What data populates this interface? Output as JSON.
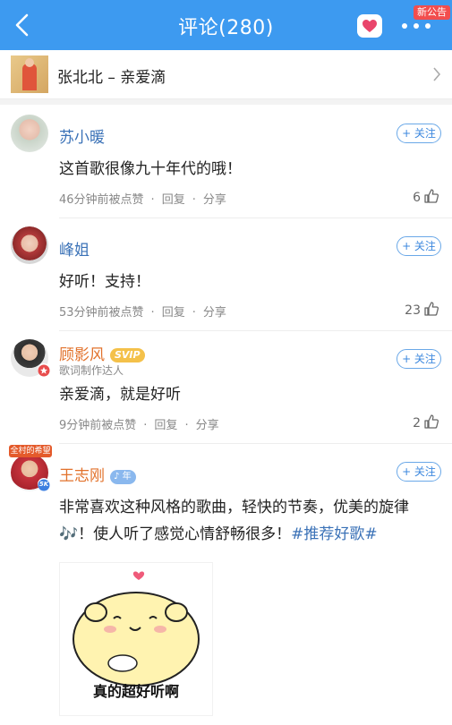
{
  "header": {
    "title": "评论(280)",
    "badge": "新公告",
    "back_icon": "back-chevron-icon",
    "heart_icon": "heart-icon",
    "more_icon": "more-dots-icon",
    "bg_color": "#3d9af0"
  },
  "song": {
    "title": "张北北 – 亲爱滴",
    "chevron_icon": "chevron-right-icon"
  },
  "comments": [
    {
      "name": "苏小暖",
      "text": "这首歌很像九十年代的哦！",
      "time": "46分钟前被点赞",
      "reply": "回复",
      "share": "分享",
      "likes": "6",
      "follow": "+ 关注"
    },
    {
      "name": "峰姐",
      "text": "好听！支持！",
      "time": "53分钟前被点赞",
      "reply": "回复",
      "share": "分享",
      "likes": "23",
      "follow": "+ 关注"
    },
    {
      "name": "顾影风",
      "badge": "SVIP",
      "subtitle": "歌词制作达人",
      "text": "亲爱滴，就是好听",
      "time": "9分钟前被点赞",
      "reply": "回复",
      "share": "分享",
      "likes": "2",
      "follow": "+ 关注"
    },
    {
      "name": "王志刚",
      "badge": "年",
      "avatar_banner": "全村的希望",
      "avatar_badge": "5K",
      "text_main": "非常喜欢这种风格的歌曲，轻快的节奏，优美的旋律🎶！使人听了感觉心情舒畅很多！",
      "tag": "#推荐好歌#",
      "sticker_caption": "真的超好听啊",
      "follow": "+ 关注"
    }
  ],
  "dot": "·"
}
